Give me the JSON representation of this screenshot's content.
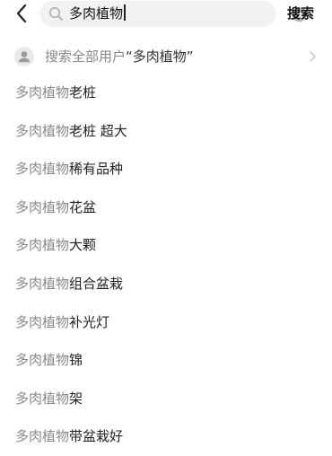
{
  "search": {
    "query": "多肉植物",
    "submit_label": "搜索"
  },
  "user_search": {
    "prefix": "搜索全部用户",
    "query": "“多肉植物”"
  },
  "suggestions": [
    {
      "prefix": "多肉植物",
      "rest": "老桩"
    },
    {
      "prefix": "多肉植物",
      "rest": "老桩 超大"
    },
    {
      "prefix": "多肉植物",
      "rest": "稀有品种"
    },
    {
      "prefix": "多肉植物",
      "rest": "花盆"
    },
    {
      "prefix": "多肉植物",
      "rest": "大颗"
    },
    {
      "prefix": "多肉植物",
      "rest": "组合盆栽"
    },
    {
      "prefix": "多肉植物",
      "rest": "补光灯"
    },
    {
      "prefix": "多肉植物",
      "rest": "锦"
    },
    {
      "prefix": "多肉植物",
      "rest": "架"
    },
    {
      "prefix": "多肉植物",
      "rest": "带盆栽好"
    }
  ],
  "icons": {
    "back": "back-arrow-icon",
    "search": "search-icon",
    "clear": "clear-icon",
    "user": "user-icon",
    "chevron": "chevron-right-icon"
  },
  "colors": {
    "muted_text": "#888888",
    "input_bg": "#f2f2f2"
  }
}
